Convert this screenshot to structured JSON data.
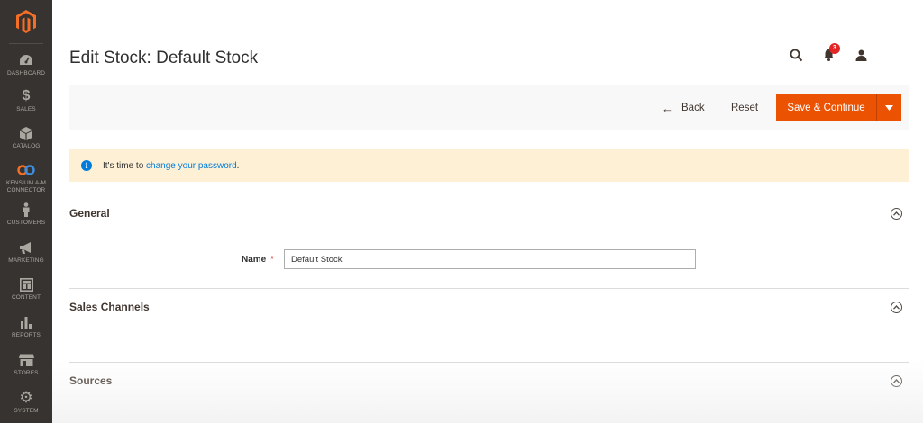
{
  "sidebar": {
    "items": [
      {
        "label": "DASHBOARD",
        "icon": "dashboard-icon"
      },
      {
        "label": "SALES",
        "icon": "dollar-icon"
      },
      {
        "label": "CATALOG",
        "icon": "cube-icon"
      },
      {
        "label": "KENSIUM A-M CONNECTOR",
        "line1": "KENSIUM A-M",
        "line2": "CONNECTOR",
        "icon": "connector-icon"
      },
      {
        "label": "CUSTOMERS",
        "icon": "person-icon"
      },
      {
        "label": "MARKETING",
        "icon": "megaphone-icon"
      },
      {
        "label": "CONTENT",
        "icon": "layout-icon"
      },
      {
        "label": "REPORTS",
        "icon": "bar-chart-icon"
      },
      {
        "label": "STORES",
        "icon": "storefront-icon"
      },
      {
        "label": "SYSTEM",
        "icon": "gear-icon"
      }
    ]
  },
  "header": {
    "title": "Edit Stock: Default Stock",
    "notifications_count": "3"
  },
  "actions": {
    "back_label": "Back",
    "reset_label": "Reset",
    "save_label": "Save & Continue"
  },
  "message": {
    "prefix": "It's time to ",
    "link": "change your password",
    "suffix": "."
  },
  "sections": {
    "general": {
      "title": "General",
      "name_label": "Name",
      "name_value": "Default Stock"
    },
    "sales_channels": {
      "title": "Sales Channels"
    },
    "sources": {
      "title": "Sources"
    }
  },
  "colors": {
    "sidebar_bg": "#373330",
    "accent": "#eb5202",
    "message_bg": "#fdf0d5",
    "link": "#007bdb"
  }
}
